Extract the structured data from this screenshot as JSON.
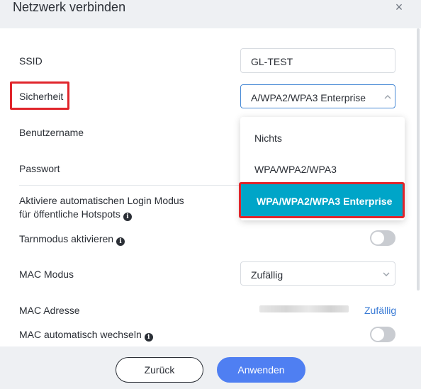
{
  "dialog": {
    "title": "Netzwerk verbinden",
    "close_glyph": "×"
  },
  "form": {
    "ssid_label": "SSID",
    "ssid_value": "GL-TEST",
    "security_label": "Sicherheit",
    "security_value": "A/WPA2/WPA3 Enterprise",
    "username_label": "Benutzername",
    "password_label": "Passwort",
    "auto_login_label_line1": "Aktiviere automatischen Login Modus",
    "auto_login_label_line2": "für öffentliche Hotspots",
    "stealth_label": "Tarnmodus aktivieren",
    "mac_mode_label": "MAC Modus",
    "mac_mode_value": "Zufällig",
    "mac_address_label": "MAC Adresse",
    "mac_address_link": "Zufällig",
    "mac_auto_change_label": "MAC automatisch wechseln",
    "stealth_toggle_on": false,
    "mac_auto_toggle_on": false
  },
  "security_dropdown": {
    "options": [
      "Nichts",
      "WPA/WPA2/WPA3",
      "WPA/WPA2/WPA3 Enterprise"
    ],
    "selected_index": 2,
    "selected_color": "#00a5c8"
  },
  "footer": {
    "back_label": "Zurück",
    "apply_label": "Anwenden"
  },
  "colors": {
    "highlight_box": "#e0252b",
    "primary_button": "#4f7ff2",
    "link": "#3a7bd5"
  }
}
